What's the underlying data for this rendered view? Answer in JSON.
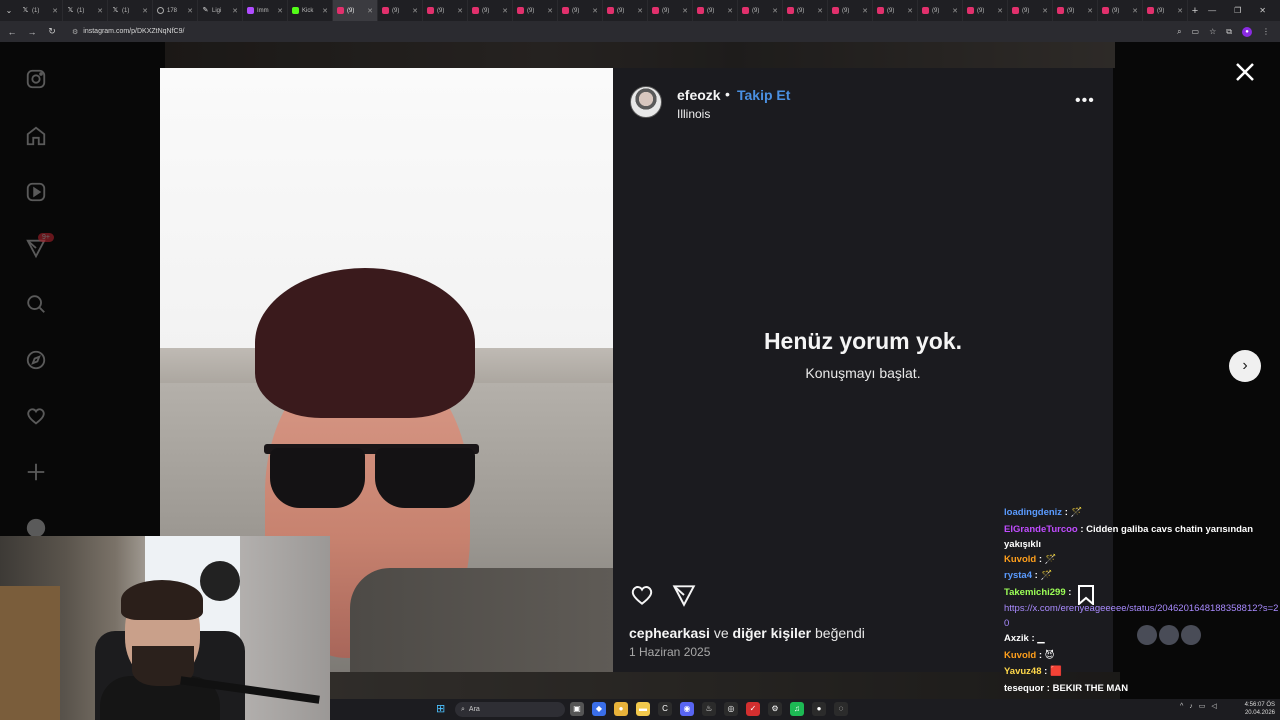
{
  "browser": {
    "tabs": [
      {
        "label": "(1)",
        "icon": "x-icon"
      },
      {
        "label": "(1)",
        "icon": "x-icon"
      },
      {
        "label": "(1)",
        "icon": "x-icon"
      },
      {
        "label": "178",
        "icon": "globe-icon"
      },
      {
        "label": "Ligi",
        "icon": "pen-icon"
      },
      {
        "label": "Imm",
        "icon": "app-icon"
      },
      {
        "label": "Kick",
        "icon": "kick-icon"
      },
      {
        "label": "(9)",
        "icon": "instagram-icon"
      },
      {
        "label": "(9)",
        "icon": "instagram-icon"
      },
      {
        "label": "(9)",
        "icon": "instagram-icon"
      },
      {
        "label": "(9)",
        "icon": "instagram-icon"
      },
      {
        "label": "(9)",
        "icon": "instagram-icon"
      },
      {
        "label": "(9)",
        "icon": "instagram-icon"
      },
      {
        "label": "(9)",
        "icon": "instagram-icon"
      },
      {
        "label": "(9)",
        "icon": "instagram-icon"
      },
      {
        "label": "(9)",
        "icon": "instagram-icon"
      },
      {
        "label": "(9)",
        "icon": "instagram-icon"
      },
      {
        "label": "(9)",
        "icon": "instagram-icon"
      },
      {
        "label": "(9)",
        "icon": "instagram-icon"
      },
      {
        "label": "(9)",
        "icon": "instagram-icon"
      },
      {
        "label": "(9)",
        "icon": "instagram-icon"
      },
      {
        "label": "(9)",
        "icon": "instagram-icon"
      },
      {
        "label": "(9)",
        "icon": "instagram-icon"
      },
      {
        "label": "(9)",
        "icon": "instagram-icon"
      },
      {
        "label": "(9)",
        "icon": "instagram-icon"
      },
      {
        "label": "(9)",
        "icon": "instagram-icon"
      }
    ],
    "active_tab_index": 7,
    "url": "instagram.com/p/DKXZtNqNfC9/"
  },
  "sidebar": {
    "notification_badge": "9+"
  },
  "post": {
    "username": "efeozk",
    "separator": "•",
    "follow_label": "Takip Et",
    "location": "Illinois",
    "more_label": "•••",
    "empty_title": "Henüz yorum yok.",
    "empty_subtitle": "Konuşmayı başlat.",
    "likes_user": "cephearkasi",
    "likes_and": "ve",
    "likes_others": "diğer kişiler",
    "likes_verb": "beğendi",
    "date": "1 Haziran 2025"
  },
  "chat": {
    "messages": [
      {
        "user": "loadingdeniz",
        "user_color": "#5a9bff",
        "sep": " :",
        "text": " 🪄"
      },
      {
        "user": "ElGrandeTurcoo",
        "user_color": "#c04cff",
        "sep": " :",
        "text": " Cidden galiba cavs chatin yarısından yakışıklı"
      },
      {
        "user": "Kuvold",
        "user_color": "#ff9f1c",
        "sep": " :",
        "text": " 🪄"
      },
      {
        "user": "rysta4",
        "user_color": "#5a9bff",
        "sep": " :",
        "text": " 🪄"
      },
      {
        "user": "Takemichi299",
        "user_color": "#9cff57",
        "sep": " :",
        "text": ""
      },
      {
        "user": "",
        "user_color": "#ffffff",
        "sep": "",
        "text": "https://x.com/erenyeageeeee/status/2046201648188358812?s=20"
      },
      {
        "user": "Axzik",
        "user_color": "#ffffff",
        "sep": " :",
        "text": " ▁"
      },
      {
        "user": "Kuvold",
        "user_color": "#ff9f1c",
        "sep": " :",
        "text": " 😈"
      },
      {
        "user": "Yavuz48",
        "user_color": "#ffd84a",
        "sep": " :",
        "text": " 🟥"
      },
      {
        "user": "tesequor",
        "user_color": "#ffffff",
        "sep": " :",
        "text": " BEKIR THE MAN"
      }
    ]
  },
  "taskbar": {
    "search_placeholder": "Ara",
    "time": "4:56:07 ÖS",
    "date": "20.04.2026"
  },
  "colors": {
    "accent_blue": "#4a90e2",
    "panel_bg": "#1b1b1f",
    "badge_red": "#ff3040"
  }
}
